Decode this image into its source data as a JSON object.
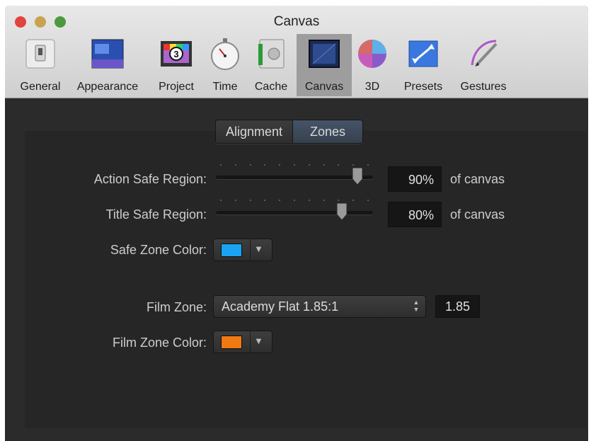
{
  "window": {
    "title": "Canvas"
  },
  "toolbar": {
    "items": [
      {
        "label": "General"
      },
      {
        "label": "Appearance"
      },
      {
        "label": "Project"
      },
      {
        "label": "Time"
      },
      {
        "label": "Cache"
      },
      {
        "label": "Canvas"
      },
      {
        "label": "3D"
      },
      {
        "label": "Presets"
      },
      {
        "label": "Gestures"
      }
    ],
    "active": "Canvas"
  },
  "tabs": {
    "alignment": "Alignment",
    "zones": "Zones",
    "selected": "Zones"
  },
  "action_safe": {
    "label": "Action Safe Region:",
    "value": "90%",
    "unit": "of canvas",
    "slider_fraction": 0.9
  },
  "title_safe": {
    "label": "Title Safe Region:",
    "value": "80%",
    "unit": "of canvas",
    "slider_fraction": 0.8
  },
  "safe_zone_color": {
    "label": "Safe Zone Color:",
    "color": "#1aa3f0"
  },
  "film_zone": {
    "label": "Film Zone:",
    "selected": "Academy Flat 1.85:1",
    "ratio": "1.85"
  },
  "film_zone_color": {
    "label": "Film Zone Color:",
    "color": "#f07a12"
  },
  "icons": {
    "general": "light-switch-icon",
    "appearance": "window-layout-icon",
    "project": "film-leader-icon",
    "time": "stopwatch-icon",
    "cache": "memory-card-icon",
    "canvas": "canvas-icon",
    "3d": "sphere-icon",
    "presets": "presets-icon",
    "gestures": "stylus-icon"
  }
}
